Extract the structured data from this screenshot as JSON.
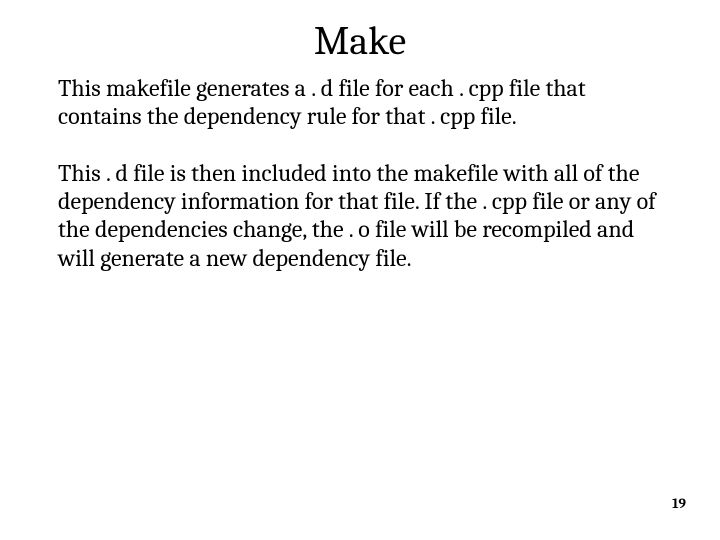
{
  "slide": {
    "title": "Make",
    "paragraph1": "This makefile generates a . d file for each . cpp file that contains the dependency rule for that . cpp file.",
    "paragraph2": "This . d file is then included into the makefile with all of the dependency information for that file. If the . cpp file or any of the dependencies change, the . o file will be recompiled and will generate a new dependency file.",
    "page_number": "19"
  }
}
